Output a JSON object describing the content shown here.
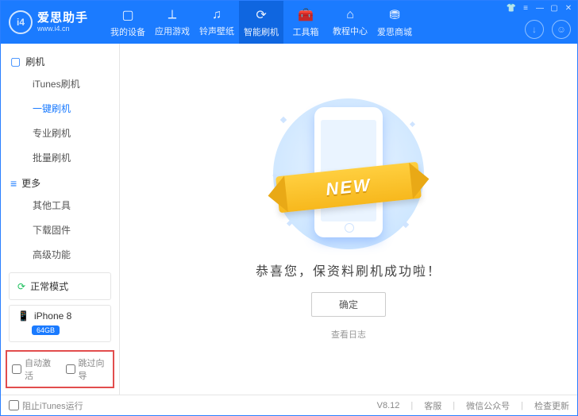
{
  "brand": {
    "name": "爱思助手",
    "domain": "www.i4.cn",
    "logo_label": "i4"
  },
  "titlebar_tabs": [
    {
      "label": "我的设备",
      "icon": "▢"
    },
    {
      "label": "应用游戏",
      "icon": "⟂"
    },
    {
      "label": "铃声壁纸",
      "icon": "♫"
    },
    {
      "label": "智能刷机",
      "icon": "⟳",
      "active": true
    },
    {
      "label": "工具箱",
      "icon": "🧰"
    },
    {
      "label": "教程中心",
      "icon": "⌂"
    },
    {
      "label": "爱思商城",
      "icon": "⛃"
    }
  ],
  "title_right_icons": [
    "download-icon",
    "user-icon"
  ],
  "window_controls": [
    "tshirt",
    "menu",
    "minimize",
    "maximize",
    "close"
  ],
  "sidebar": {
    "groups": [
      {
        "icon": "▢",
        "title": "刷机",
        "items": [
          {
            "label": "iTunes刷机"
          },
          {
            "label": "一键刷机",
            "active": true
          },
          {
            "label": "专业刷机"
          },
          {
            "label": "批量刷机"
          }
        ]
      },
      {
        "icon": "≡",
        "title": "更多",
        "items": [
          {
            "label": "其他工具"
          },
          {
            "label": "下载固件"
          },
          {
            "label": "高级功能"
          }
        ]
      }
    ],
    "mode": {
      "icon": "↻",
      "label": "正常模式"
    },
    "device": {
      "icon": "▯",
      "name": "iPhone 8",
      "badge": "64GB"
    },
    "options": [
      {
        "label": "自动激活",
        "checked": false
      },
      {
        "label": "跳过向导",
        "checked": false
      }
    ]
  },
  "main": {
    "ribbon": "NEW",
    "success_text": "恭喜您，保资料刷机成功啦！",
    "ok_button": "确定",
    "log_link": "查看日志"
  },
  "footer": {
    "block_itunes": {
      "label": "阻止iTunes运行",
      "checked": false
    },
    "version": "V8.12",
    "links": [
      "客服",
      "微信公众号",
      "检查更新"
    ]
  }
}
